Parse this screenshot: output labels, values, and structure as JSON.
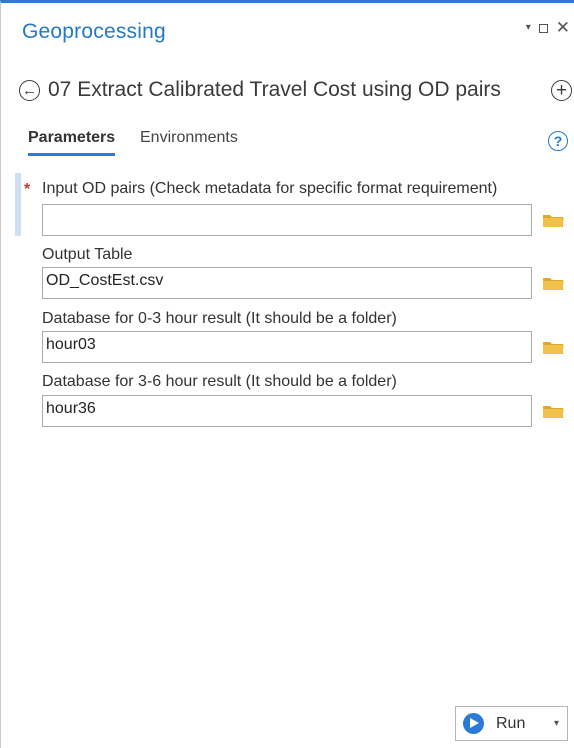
{
  "pane": {
    "title": "Geoprocessing",
    "controls": {
      "menu": "▾",
      "close": "✕"
    }
  },
  "tool": {
    "back_icon": "back-arrow-circle-icon",
    "title": "07 Extract Calibrated Travel Cost using OD pairs",
    "add_icon": "add-circle-icon"
  },
  "tabs": [
    {
      "label": "Parameters",
      "active": true
    },
    {
      "label": "Environments",
      "active": false
    }
  ],
  "help": "?",
  "parameters": [
    {
      "label": "Input OD pairs (Check metadata for specific format requirement)",
      "value": "",
      "required": true,
      "required_marker": "*"
    },
    {
      "label": "Output Table",
      "value": "OD_CostEst.csv",
      "required": false
    },
    {
      "label": "Database for 0-3 hour result (It should be a folder)",
      "value": "hour03",
      "required": false
    },
    {
      "label": "Database for 3-6 hour result (It should be a folder)",
      "value": "hour36",
      "required": false
    }
  ],
  "run": {
    "label": "Run",
    "caret": "▾"
  },
  "colors": {
    "accent": "#2b79d8",
    "title": "#2478c8",
    "required": "#c0392b",
    "folder": "#f2c14a"
  }
}
